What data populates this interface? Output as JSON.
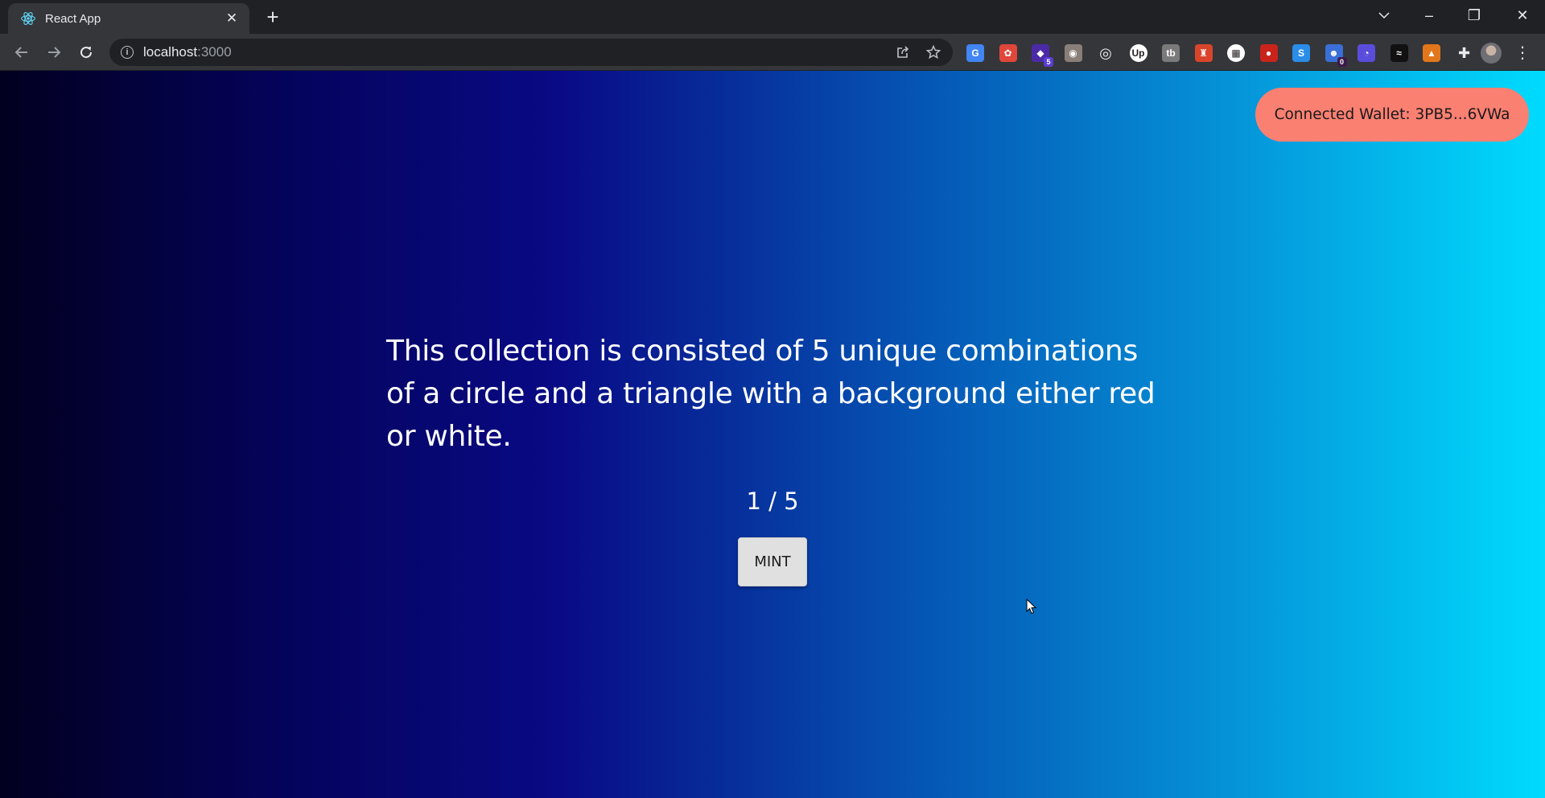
{
  "browser": {
    "tab": {
      "title": "React App",
      "favicon": "react-logo-icon",
      "close": "✕"
    },
    "new_tab": "+",
    "window_controls": {
      "dropdown": "chevron-down-icon",
      "minimize": "–",
      "restore": "❐",
      "close": "✕"
    },
    "url": {
      "host": "localhost",
      "port": ":3000"
    },
    "extensions": [
      {
        "icon": "translate-icon",
        "color": "#4285f4",
        "text": "G"
      },
      {
        "icon": "red-extension-icon",
        "color": "#e0463a",
        "text": "✿"
      },
      {
        "icon": "purple-extension-icon",
        "color": "#4b2aa8",
        "text": "◆",
        "badge": "5"
      },
      {
        "icon": "owl-extension-icon",
        "color": "#8a7f78",
        "text": "◉"
      },
      {
        "icon": "target-extension-icon",
        "color": "#35363a",
        "text": "◎"
      },
      {
        "icon": "upwork-icon",
        "color": "#ffffff",
        "text": "Up"
      },
      {
        "icon": "tb-extension-icon",
        "color": "#7a7a7a",
        "text": "tb"
      },
      {
        "icon": "rocket-extension-icon",
        "color": "#d9452b",
        "text": "♜"
      },
      {
        "icon": "qr-code-icon",
        "color": "#ffffff",
        "text": "▦"
      },
      {
        "icon": "tomato-icon",
        "color": "#c9241c",
        "text": "●"
      },
      {
        "icon": "s-extension-icon",
        "color": "#2a8de8",
        "text": "S"
      },
      {
        "icon": "ghost-extension-icon",
        "color": "#3a6fd8",
        "text": "☻",
        "badge": "0"
      },
      {
        "icon": "bot-extension-icon",
        "color": "#5b4ddb",
        "text": "◔"
      },
      {
        "icon": "wave-extension-icon",
        "color": "#111111",
        "text": "≈"
      },
      {
        "icon": "metamask-fox-icon",
        "color": "#e2761b",
        "text": "▲"
      },
      {
        "icon": "puzzle-icon",
        "color": "#35363a",
        "text": "✚"
      }
    ],
    "menu": "⋮"
  },
  "page": {
    "wallet_label": "Connected Wallet: 3PB5...6VWa",
    "description": "This collection is consisted of 5 unique combinations of a circle and a triangle with a background either red or white.",
    "counter": "1 / 5",
    "mint_label": "MINT"
  },
  "colors": {
    "wallet_bg": "#fa8072",
    "gradient": [
      "#02001f",
      "#090a85",
      "#0557b5",
      "#00dbfe"
    ]
  }
}
